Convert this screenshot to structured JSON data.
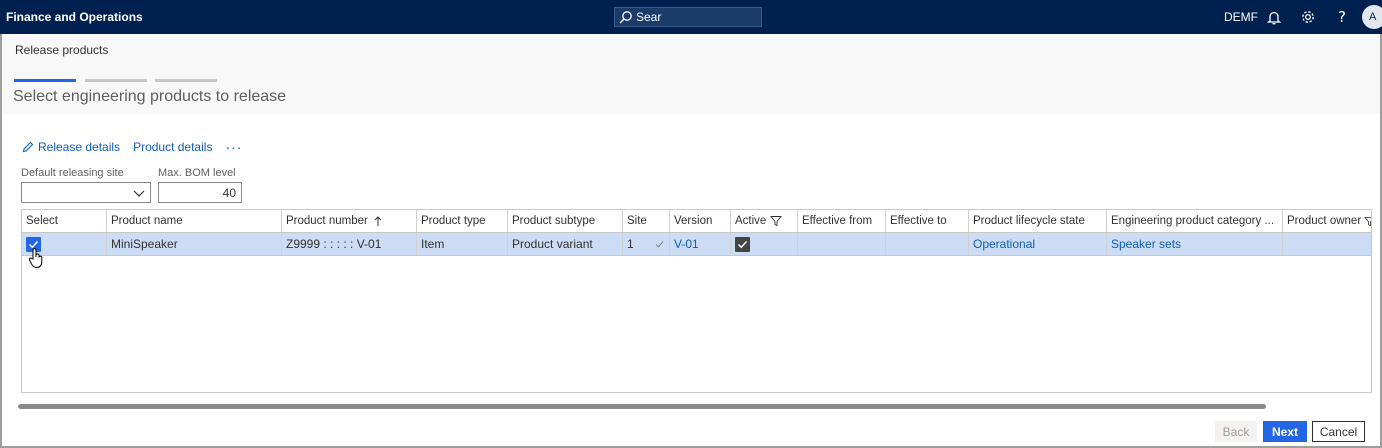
{
  "app": {
    "title": "Finance and Operations",
    "company": "DEMF",
    "avatar_initials": "A"
  },
  "search": {
    "value": "Sear",
    "placeholder": "Search"
  },
  "icons": {
    "search": "search-icon",
    "bell": "bell-icon",
    "settings": "gear-icon",
    "help": "help-icon"
  },
  "dialog": {
    "title": "Release products",
    "heading": "Select engineering products to release",
    "steps": [
      {
        "active": true
      },
      {
        "active": false
      },
      {
        "active": false
      }
    ]
  },
  "actions": {
    "release_details": "Release details",
    "product_details": "Product details",
    "more": "···"
  },
  "fields": {
    "default_site_label": "Default releasing site",
    "default_site_value": "",
    "max_bom_label": "Max. BOM level",
    "max_bom_value": "40"
  },
  "grid": {
    "columns": [
      "Select",
      "Product name",
      "Product number",
      "Product type",
      "Product subtype",
      "Site",
      "Version",
      "Active",
      "Effective from",
      "Effective to",
      "Product lifecycle state",
      "Engineering product category ...",
      "Product owner"
    ],
    "rows": [
      {
        "select": true,
        "product_name": "MiniSpeaker",
        "product_number": "Z9999 : : : : : V-01",
        "product_type": "Item",
        "product_subtype": "Product variant",
        "site": "1",
        "version": "V-01",
        "active": true,
        "effective_from": "",
        "effective_to": "",
        "lifecycle_state": "Operational",
        "category": "Speaker sets",
        "owner": ""
      }
    ]
  },
  "footer": {
    "back": "Back",
    "next": "Next",
    "cancel": "Cancel"
  },
  "colors": {
    "topbar": "#002050",
    "accent": "#2266e3",
    "selected_row": "#ccdcf4",
    "link": "#0f5db4"
  }
}
